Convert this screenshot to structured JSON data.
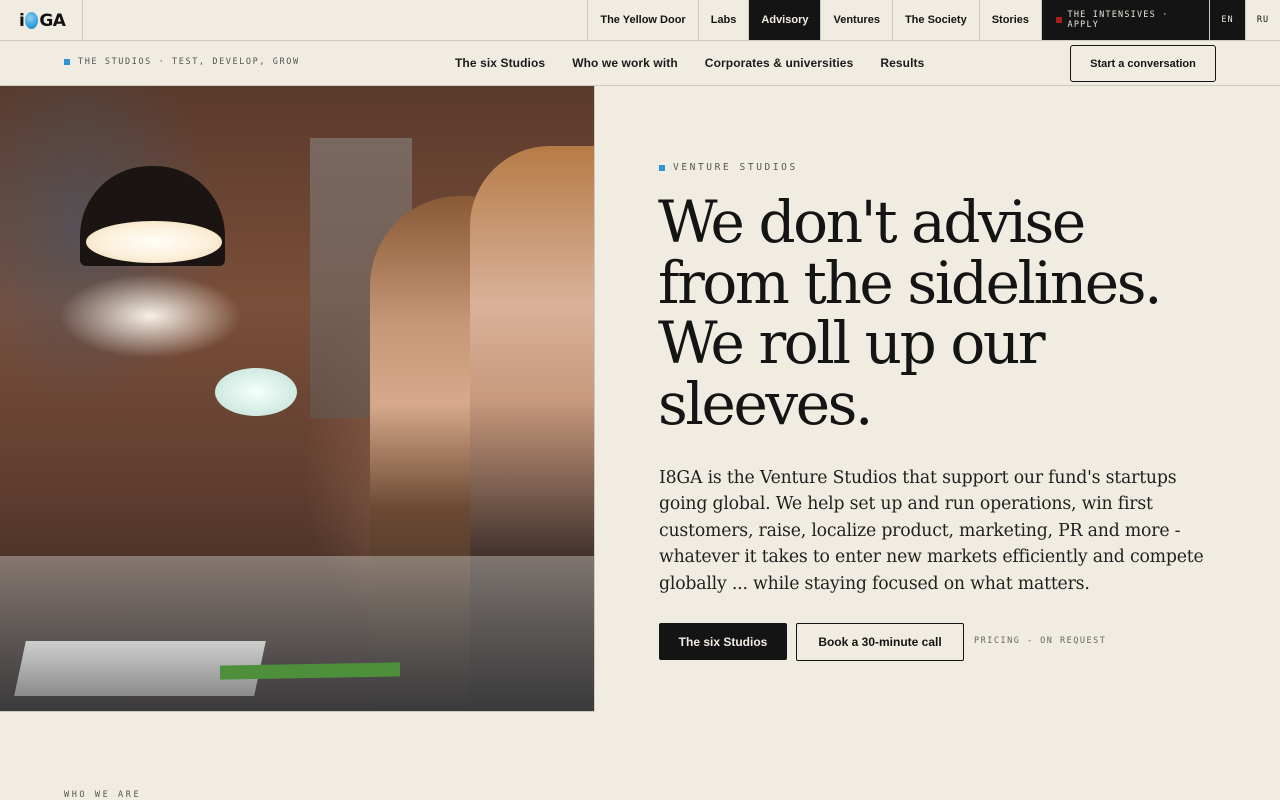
{
  "brand": {
    "logo_left": "i",
    "logo_right": "GA"
  },
  "topnav": {
    "items": [
      "The Yellow Door",
      "Labs",
      "Advisory",
      "Ventures",
      "The Society",
      "Stories"
    ],
    "active": "Advisory",
    "intensives": "THE INTENSIVES · APPLY",
    "lang_en": "EN",
    "lang_ru": "RU"
  },
  "subbar": {
    "kicker": "THE STUDIOS · TEST, DEVELOP, GROW",
    "links": [
      "The six Studios",
      "Who we work with",
      "Corporates & universities",
      "Results"
    ],
    "cta": "Start a conversation"
  },
  "hero": {
    "kicker": "VENTURE STUDIOS",
    "headline_lines": [
      "We don't advise",
      "from the sidelines.",
      "We roll up our",
      "sleeves."
    ],
    "lede": "I8GA is the Venture Studios that support our fund's startups going global. We help set up and run operations, win first customers, raise, localize product, marketing, PR and more - whatever it takes to enter new markets efficiently and compete globally ... while staying focused on what matters.",
    "primary_cta": "The six Studios",
    "secondary_cta": "Book a 30-minute call",
    "pricing": "PRICING - ON REQUEST"
  },
  "next_section": {
    "kicker": "WHO WE ARE"
  },
  "colors": {
    "background": "#f1ece2",
    "ink": "#141414",
    "accent_blue": "#2d95d6",
    "intensives_dot": "#a51f1f"
  }
}
